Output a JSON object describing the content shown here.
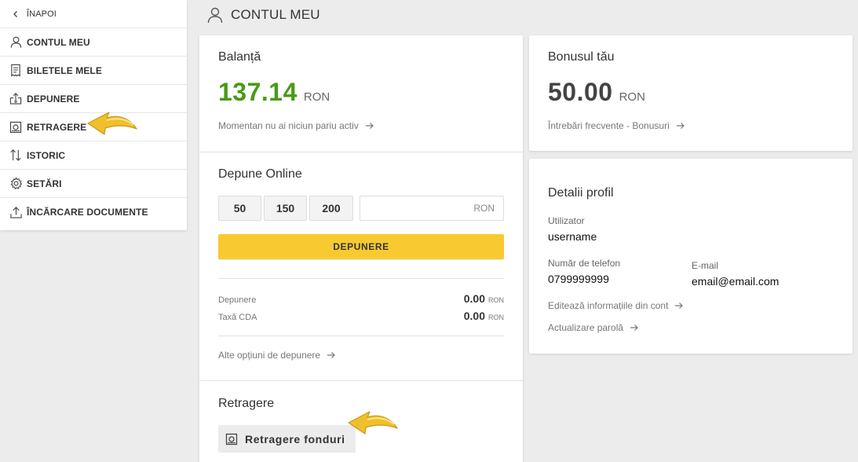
{
  "sidebar": {
    "back": "ÎNAPOI",
    "items": [
      {
        "label": "CONTUL MEU",
        "icon": "user-icon"
      },
      {
        "label": "BILETELE MELE",
        "icon": "ticket-icon"
      },
      {
        "label": "DEPUNERE",
        "icon": "deposit-icon"
      },
      {
        "label": "RETRAGERE",
        "icon": "withdraw-icon"
      },
      {
        "label": "ISTORIC",
        "icon": "history-icon"
      },
      {
        "label": "SETĂRI",
        "icon": "gear-icon"
      },
      {
        "label": "ÎNCĂRCARE DOCUMENTE",
        "icon": "upload-icon"
      }
    ]
  },
  "header": {
    "title": "CONTUL MEU"
  },
  "balance": {
    "title": "Balanță",
    "amount": "137.14",
    "currency": "RON",
    "link": "Momentan nu ai niciun pariu activ"
  },
  "deposit": {
    "title": "Depune Online",
    "amounts": [
      "50",
      "150",
      "200"
    ],
    "input_placeholder": "RON",
    "button": "DEPUNERE",
    "rows": [
      {
        "label": "Depunere",
        "value": "0.00",
        "currency": "RON"
      },
      {
        "label": "Taxă CDA",
        "value": "0.00",
        "currency": "RON"
      }
    ],
    "more_link": "Alte opțiuni de depunere"
  },
  "withdraw": {
    "title": "Retragere",
    "button": "Retragere fonduri"
  },
  "bonus": {
    "title": "Bonusul tău",
    "amount": "50.00",
    "currency": "RON",
    "link": "Întrebări frecvente - Bonusuri"
  },
  "profile": {
    "title": "Detalii profil",
    "user_label": "Utilizator",
    "user_value": "username",
    "phone_label": "Număr de telefon",
    "phone_value": "0799999999",
    "email_label": "E-mail",
    "email_value": "email@email.com",
    "edit_link": "Editează informațiile din cont",
    "password_link": "Actualizare parolă"
  },
  "colors": {
    "accent": "#f8ca2f",
    "balance_green": "#4a9a16",
    "bonus_dark": "#444444",
    "pointer": "#e9b92a"
  }
}
